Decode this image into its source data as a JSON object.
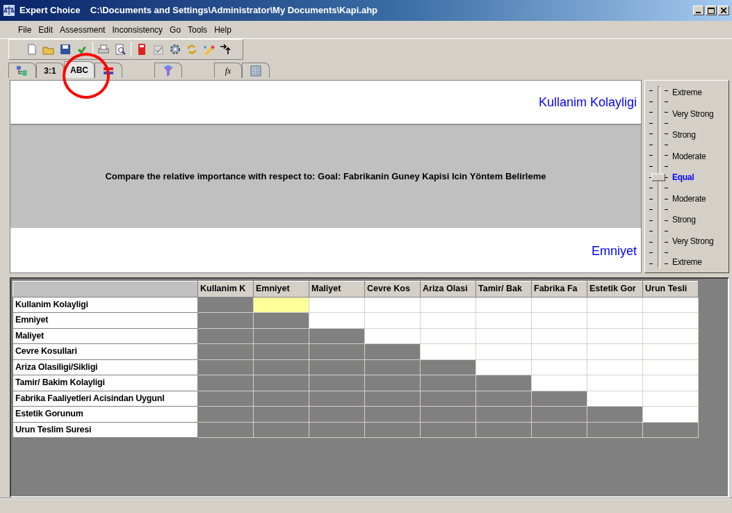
{
  "window": {
    "app": "Expert Choice",
    "path": "C:\\Documents and Settings\\Administrator\\My Documents\\Kapi.ahp"
  },
  "menu": [
    "File",
    "Edit",
    "Assessment",
    "Inconsistency",
    "Go",
    "Tools",
    "Help"
  ],
  "tabs": [
    {
      "kind": "icon",
      "selected": false
    },
    {
      "kind": "text",
      "label": "3:1",
      "selected": false
    },
    {
      "kind": "text",
      "label": "ABC",
      "selected": true
    },
    {
      "kind": "icon",
      "selected": false
    },
    {
      "kind": "icon",
      "selected": false
    },
    {
      "kind": "formula",
      "label": "fx",
      "selected": false
    },
    {
      "kind": "icon",
      "selected": false
    }
  ],
  "comparison": {
    "top": "Kullanim Kolayligi",
    "question": "Compare the relative importance with respect to: Goal: Fabrikanin Guney Kapisi Icin Yöntem Belirleme",
    "bottom": "Emniyet"
  },
  "scale": {
    "level": 0.5,
    "labels": [
      {
        "label": "Extreme",
        "selected": false
      },
      {
        "label": "Very Strong",
        "selected": false
      },
      {
        "label": "Strong",
        "selected": false
      },
      {
        "label": "Moderate",
        "selected": false
      },
      {
        "label": "Equal",
        "selected": true
      },
      {
        "label": "Moderate",
        "selected": false
      },
      {
        "label": "Strong",
        "selected": false
      },
      {
        "label": "Very Strong",
        "selected": false
      },
      {
        "label": "Extreme",
        "selected": false
      }
    ]
  },
  "table": {
    "columns": [
      "Kullanim K",
      "Emniyet",
      "Maliyet",
      "Cevre Kos",
      "Ariza Olasi",
      "Tamir/ Bak",
      "Fabrika Fa",
      "Estetik Gor",
      "Urun Tesli"
    ],
    "rows": [
      {
        "label": "Kullanim Kolayligi",
        "cells": [
          {
            "selected": true
          },
          {
            "selected": false
          },
          {
            "selected": false
          },
          {
            "selected": false
          },
          {
            "selected": false
          },
          {
            "selected": false
          },
          {
            "selected": false
          },
          {
            "selected": false
          }
        ]
      },
      {
        "label": "Emniyet",
        "cells": [
          {
            "selected": false
          },
          {
            "selected": false
          },
          {
            "selected": false
          },
          {
            "selected": false
          },
          {
            "selected": false
          },
          {
            "selected": false
          },
          {
            "selected": false
          }
        ]
      },
      {
        "label": "Maliyet",
        "cells": [
          {
            "selected": false
          },
          {
            "selected": false
          },
          {
            "selected": false
          },
          {
            "selected": false
          },
          {
            "selected": false
          },
          {
            "selected": false
          }
        ]
      },
      {
        "label": "Cevre Kosullari",
        "cells": [
          {
            "selected": false
          },
          {
            "selected": false
          },
          {
            "selected": false
          },
          {
            "selected": false
          },
          {
            "selected": false
          }
        ]
      },
      {
        "label": "Ariza Olasiligi/Sikligi",
        "cells": [
          {
            "selected": false
          },
          {
            "selected": false
          },
          {
            "selected": false
          },
          {
            "selected": false
          }
        ]
      },
      {
        "label": "Tamir/ Bakim Kolayligi",
        "cells": [
          {
            "selected": false
          },
          {
            "selected": false
          },
          {
            "selected": false
          }
        ]
      },
      {
        "label": "Fabrika Faaliyetleri Acisindan Uygunl",
        "cells": [
          {
            "selected": false
          },
          {
            "selected": false
          }
        ]
      },
      {
        "label": "Estetik Gorunum",
        "cells": [
          {
            "selected": false
          }
        ]
      },
      {
        "label": "Urun Teslim Suresi"
      }
    ]
  }
}
